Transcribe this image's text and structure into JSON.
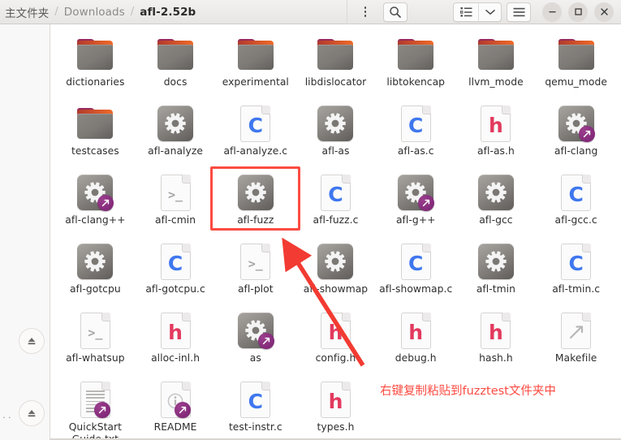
{
  "window": {
    "breadcrumb": [
      {
        "label": "主文件夹",
        "current": false
      },
      {
        "label": "Downloads",
        "current": false
      },
      {
        "label": "afl-2.52b",
        "current": true
      }
    ],
    "separator": "/",
    "controls": {
      "menu_label": "⋮",
      "search_label": "search-icon",
      "view_list_label": "list-view-icon",
      "view_dropdown_label": "chevron-down-icon",
      "hamburger_label": "hamburger-menu-icon",
      "minimize_label": "–",
      "maximize_label": "□",
      "close_label": "✕"
    }
  },
  "sidebar": {
    "items": [
      {
        "name": "eject-device-1",
        "icon": "eject-icon"
      },
      {
        "name": "eject-device-2",
        "icon": "eject-icon"
      }
    ],
    "truncated_label": ". ."
  },
  "files": [
    {
      "name": "dictionaries",
      "type": "folder",
      "symlink": false
    },
    {
      "name": "docs",
      "type": "folder",
      "symlink": false
    },
    {
      "name": "experimental",
      "type": "folder",
      "symlink": false
    },
    {
      "name": "libdislocator",
      "type": "folder",
      "symlink": false
    },
    {
      "name": "libtokencap",
      "type": "folder",
      "symlink": false
    },
    {
      "name": "llvm_mode",
      "type": "folder",
      "symlink": false
    },
    {
      "name": "qemu_mode",
      "type": "folder",
      "symlink": false
    },
    {
      "name": "testcases",
      "type": "folder",
      "symlink": false
    },
    {
      "name": "afl-analyze",
      "type": "executable",
      "symlink": false
    },
    {
      "name": "afl-analyze.c",
      "type": "c-source",
      "symlink": false
    },
    {
      "name": "afl-as",
      "type": "executable",
      "symlink": false
    },
    {
      "name": "afl-as.c",
      "type": "c-source",
      "symlink": false
    },
    {
      "name": "afl-as.h",
      "type": "c-header",
      "symlink": false
    },
    {
      "name": "afl-clang",
      "type": "executable",
      "symlink": true
    },
    {
      "name": "afl-clang++",
      "type": "executable",
      "symlink": true
    },
    {
      "name": "afl-cmin",
      "type": "shell-script",
      "symlink": false
    },
    {
      "name": "afl-fuzz",
      "type": "executable",
      "symlink": false
    },
    {
      "name": "afl-fuzz.c",
      "type": "c-source",
      "symlink": false
    },
    {
      "name": "afl-g++",
      "type": "executable",
      "symlink": true
    },
    {
      "name": "afl-gcc",
      "type": "executable",
      "symlink": false
    },
    {
      "name": "afl-gcc.c",
      "type": "c-source",
      "symlink": false
    },
    {
      "name": "afl-gotcpu",
      "type": "executable",
      "symlink": false
    },
    {
      "name": "afl-gotcpu.c",
      "type": "c-source",
      "symlink": false
    },
    {
      "name": "afl-plot",
      "type": "shell-script",
      "symlink": false
    },
    {
      "name": "afl-showmap",
      "type": "executable",
      "symlink": false
    },
    {
      "name": "afl-showmap.c",
      "type": "c-source",
      "symlink": false
    },
    {
      "name": "afl-tmin",
      "type": "executable",
      "symlink": false
    },
    {
      "name": "afl-tmin.c",
      "type": "c-source",
      "symlink": false
    },
    {
      "name": "afl-whatsup",
      "type": "shell-script",
      "symlink": false
    },
    {
      "name": "alloc-inl.h",
      "type": "c-header",
      "symlink": false
    },
    {
      "name": "as",
      "type": "executable",
      "symlink": true
    },
    {
      "name": "config.h",
      "type": "c-header",
      "symlink": false
    },
    {
      "name": "debug.h",
      "type": "c-header",
      "symlink": false
    },
    {
      "name": "hash.h",
      "type": "c-header",
      "symlink": false
    },
    {
      "name": "Makefile",
      "type": "makefile",
      "symlink": false
    },
    {
      "name": "QuickStart Guide.txt",
      "type": "text-document",
      "symlink": true
    },
    {
      "name": "README",
      "type": "info-document",
      "symlink": true
    },
    {
      "name": "test-instr.c",
      "type": "c-source",
      "symlink": false
    },
    {
      "name": "types.h",
      "type": "c-header",
      "symlink": false
    }
  ],
  "annotations": {
    "highlight_target": "afl-fuzz",
    "note_text": "右键复制粘贴到fuzztest文件夹中",
    "color": "#fc4b42"
  }
}
